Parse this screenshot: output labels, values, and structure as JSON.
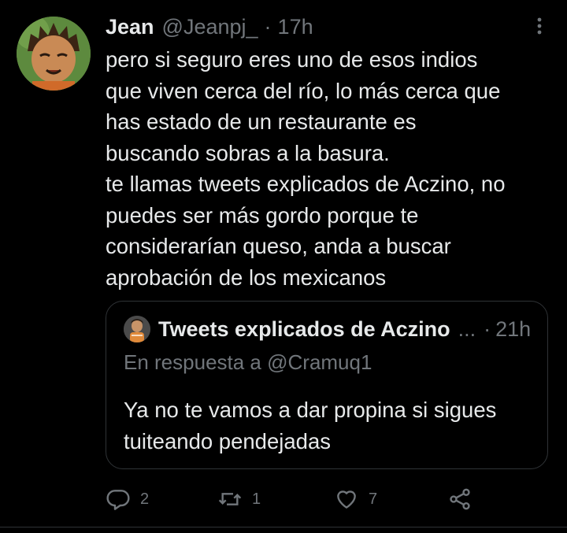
{
  "tweet": {
    "author_name": "Jean",
    "author_handle": "@Jeanpj_",
    "separator": "·",
    "time": "17h",
    "text": "pero si seguro eres uno de esos indios\nque viven cerca del río, lo más cerca que\nhas estado de un restaurante es\nbuscando sobras a la basura.\nte llamas tweets explicados de Aczino, no\npuedes ser más gordo porque te\nconsiderarían queso, anda a buscar\naprobación de los mexicanos"
  },
  "quoted_tweet": {
    "author_name": "Tweets explicados de Aczino",
    "truncation": "...",
    "separator": "·",
    "time": "21h",
    "reply_to": "En respuesta a @Cramuq1",
    "text": "Ya no te vamos a dar propina si sigues\ntuiteando pendejadas"
  },
  "actions": {
    "reply_count": "2",
    "retweet_count": "1",
    "like_count": "7"
  },
  "icons": {
    "more": "more-vertical-icon",
    "reply": "reply-icon",
    "retweet": "retweet-icon",
    "like": "heart-icon",
    "share": "share-icon"
  },
  "colors": {
    "background": "#000000",
    "primary_text": "#e7e9ea",
    "secondary_text": "#71767b",
    "border": "#2f3336"
  }
}
